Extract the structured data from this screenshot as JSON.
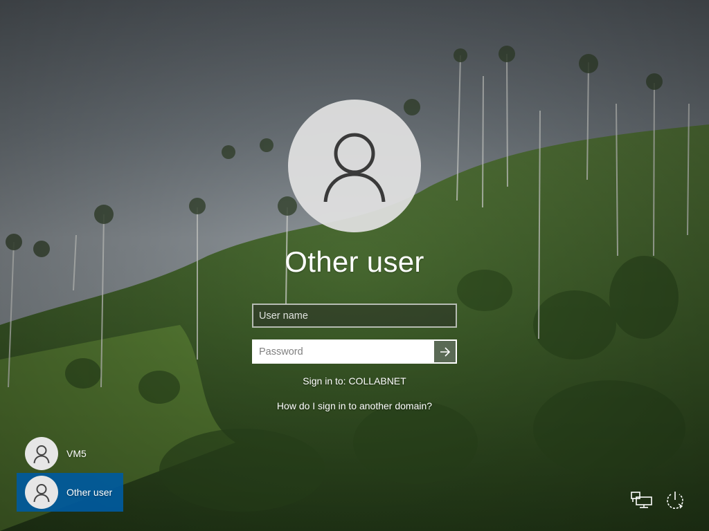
{
  "screen": {
    "type": "Windows sign-in screen",
    "background_colors": {
      "sky": "#6e767d",
      "hills": "#3e5a28"
    }
  },
  "selected_user": {
    "name": "Other user",
    "avatar_icon": "user-icon"
  },
  "form": {
    "username_placeholder": "User name",
    "password_placeholder": "Password",
    "submit_icon": "arrow-right-icon"
  },
  "sign_in_to": "Sign in to: COLLABNET",
  "domain_link": "How do I sign in to another domain?",
  "user_list": [
    {
      "label": "VM5",
      "icon": "user-icon",
      "selected": false
    },
    {
      "label": "Other user",
      "icon": "user-icon",
      "selected": true
    }
  ],
  "corner_icons": [
    "network-icon",
    "power-icon"
  ],
  "colors": {
    "selected_tile": "#005a9e",
    "submit_button": "#5a6a55"
  }
}
